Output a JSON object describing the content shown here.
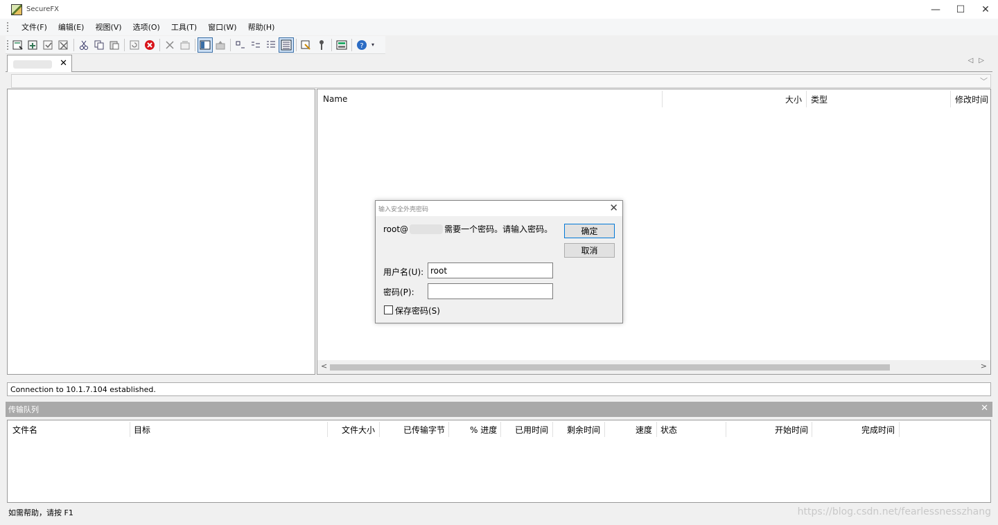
{
  "window": {
    "title": "SecureFX",
    "minimize": "—",
    "maximize": "☐",
    "close": "✕"
  },
  "menu": [
    "文件(F)",
    "编辑(E)",
    "视图(V)",
    "选项(O)",
    "工具(T)",
    "窗口(W)",
    "帮助(H)"
  ],
  "tab": {
    "close": "✕",
    "arrows": "◁▷"
  },
  "address": {
    "dropdown": "﹀"
  },
  "file_list": {
    "columns": [
      "Name",
      "大小",
      "类型",
      "修改时间"
    ]
  },
  "scroll": {
    "left": "<",
    "right": ">"
  },
  "connection_status": "Connection to 10.1.7.104 established.",
  "queue": {
    "title": "传输队列",
    "close": "✕",
    "columns": [
      "文件名",
      "目标",
      "文件大小",
      "已传输字节",
      "% 进度",
      "已用时间",
      "剩余时间",
      "速度",
      "状态",
      "开始时间",
      "完成时间"
    ]
  },
  "statusbar": {
    "help": "如需帮助，请按 F1"
  },
  "watermark": "https://blog.csdn.net/fearlessnesszhang",
  "dialog": {
    "title": "输入安全外壳密码",
    "close": "✕",
    "message_prefix": "root@",
    "message_suffix": "需要一个密码。请输入密码。",
    "ok": "确定",
    "cancel": "取消",
    "username_label": "用户名(U):",
    "username_value": "root",
    "password_label": "密码(P):",
    "password_value": "",
    "save_password_label": "保存密码(S)",
    "save_password_checked": false
  },
  "icons": [
    "new-session-icon",
    "connect-icon",
    "quick-connect-icon",
    "disconnect-icon",
    "cut-icon",
    "copy-icon",
    "paste-icon",
    "refresh-icon",
    "stop-icon",
    "delete-icon",
    "properties-icon",
    "view-tree-icon",
    "up-folder-icon",
    "large-icons-icon",
    "small-icons-icon",
    "list-icon",
    "details-icon",
    "sync-icon",
    "key-icon",
    "tools-icon",
    "help-icon"
  ]
}
